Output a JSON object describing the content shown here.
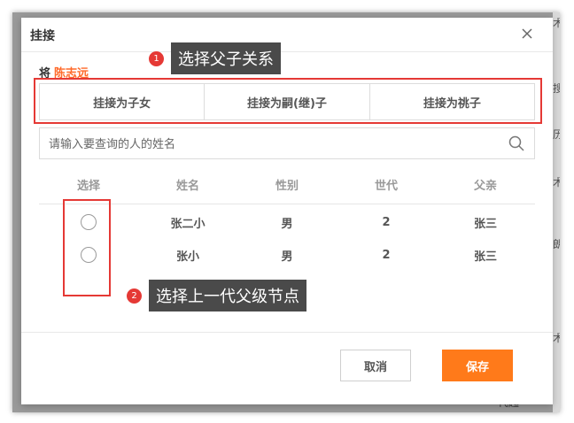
{
  "dialog": {
    "title": "挂接",
    "target_prefix": "将",
    "target_name": "陈志远"
  },
  "tabs": [
    {
      "label": "挂接为子女"
    },
    {
      "label": "挂接为嗣(继)子"
    },
    {
      "label": "挂接为祧子"
    }
  ],
  "search": {
    "placeholder": "请输入要查询的人的姓名",
    "value": ""
  },
  "table": {
    "headers": [
      "选择",
      "姓名",
      "性别",
      "世代",
      "父亲"
    ],
    "rows": [
      {
        "name": "张二小",
        "gender": "男",
        "generation": "2",
        "father": "张三"
      },
      {
        "name": "张小",
        "gender": "男",
        "generation": "2",
        "father": "张三"
      }
    ]
  },
  "buttons": {
    "cancel": "取消",
    "save": "保存"
  },
  "callouts": [
    {
      "number": "1",
      "text": "选择父子关系"
    },
    {
      "number": "2",
      "text": "选择上一代父级节点"
    }
  ],
  "background_fragments": [
    "术",
    "搜",
    "历",
    "术",
    "朗",
    "术",
    "代起"
  ],
  "colors": {
    "accent": "#ff7a1a",
    "highlight": "#e53935",
    "target_name": "#ff6a2a",
    "callout_bg": "#4a4a4a"
  },
  "icons": {
    "close": "close-icon",
    "search": "search-icon"
  }
}
